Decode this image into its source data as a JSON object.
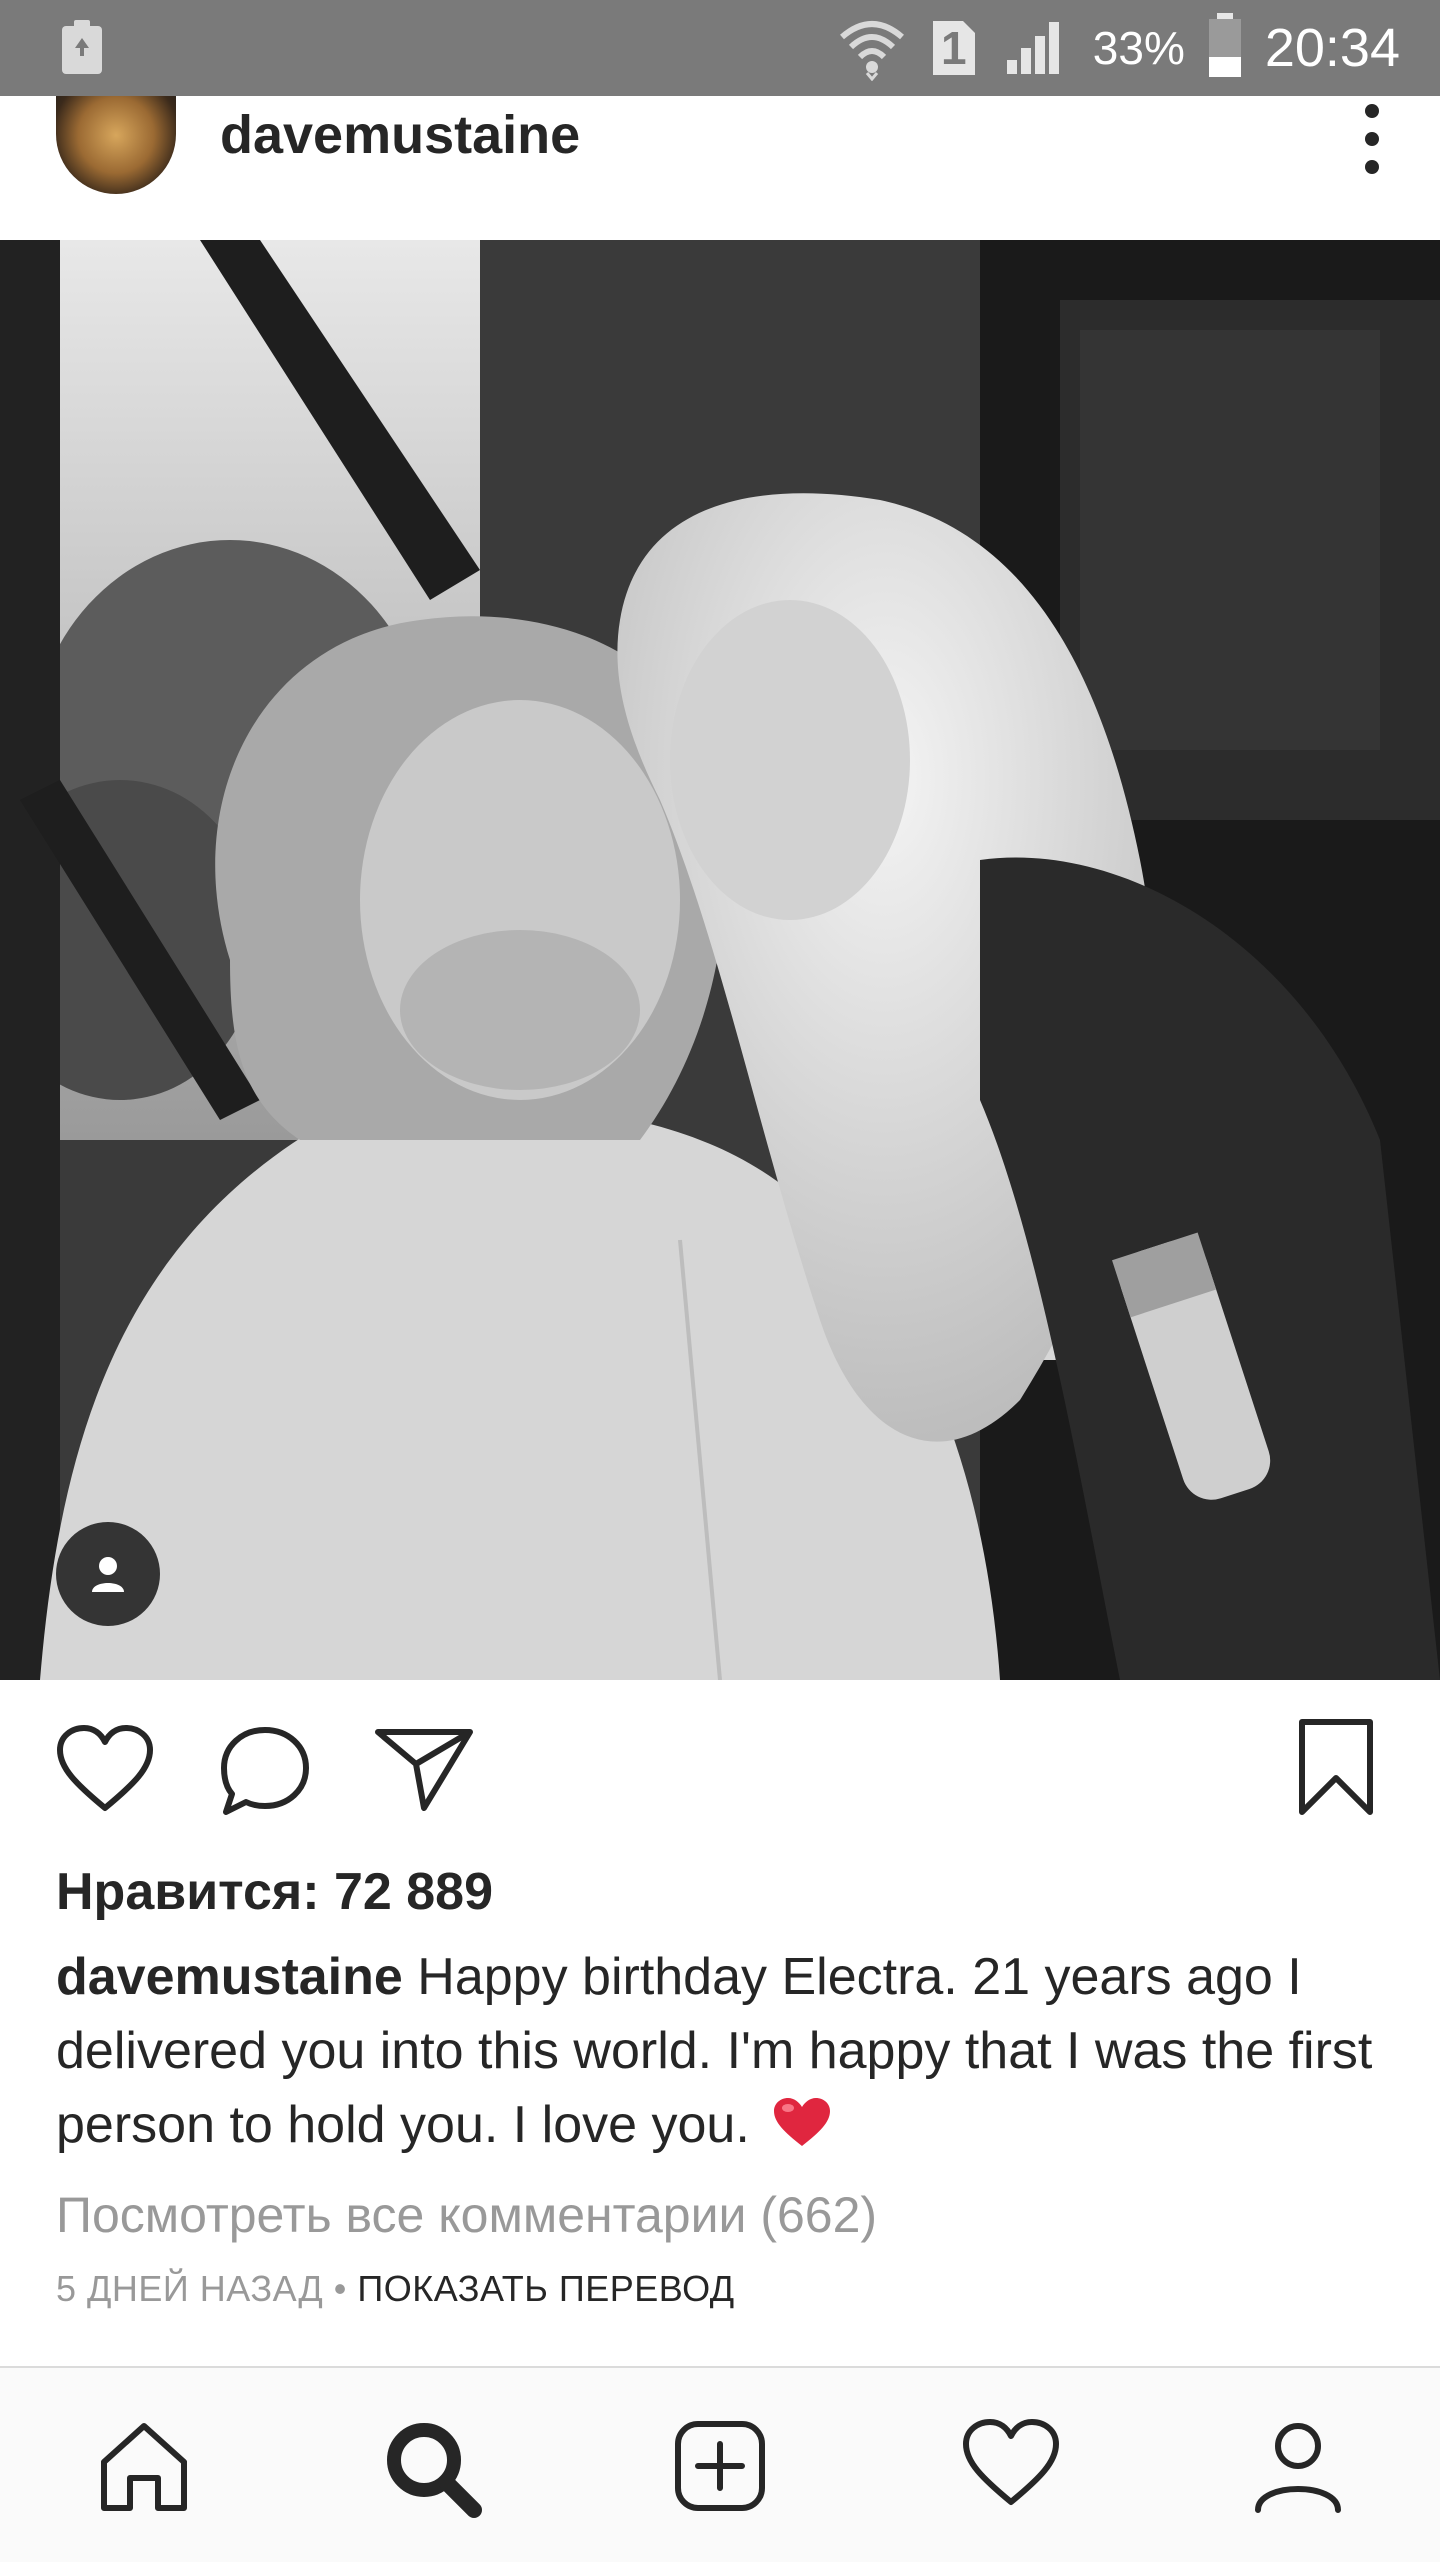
{
  "status_bar": {
    "sim_slot": "1",
    "battery": "33%",
    "time": "20:34",
    "icons": [
      "recycle-notification-icon",
      "wifi-icon",
      "sim-icon",
      "signal-icon",
      "battery-icon"
    ]
  },
  "post": {
    "username": "davemustaine",
    "likes_label": "Нравится: 72 889",
    "caption_username": "davemustaine",
    "caption_text": "Happy birthday Electra. 21 years ago I delivered you into this world. I'm happy that I was the first person to hold you. I love you.",
    "caption_emoji": "red-heart",
    "view_comments": "Посмотреть все комментарии (662)",
    "time_ago": "5 ДНЕЙ НАЗАД",
    "separator": " • ",
    "show_translation": "ПОКАЗАТЬ ПЕРЕВОД"
  },
  "actions": {
    "like": "heart-icon",
    "comment": "comment-icon",
    "share": "send-icon",
    "save": "bookmark-icon"
  },
  "bottom_nav": [
    "home-icon",
    "search-icon",
    "new-post-icon",
    "activity-heart-icon",
    "profile-icon"
  ],
  "colors": {
    "status_bar": "#7a7a7a",
    "text": "#262626",
    "muted": "#999999",
    "heart_emoji": "#e0263f"
  }
}
